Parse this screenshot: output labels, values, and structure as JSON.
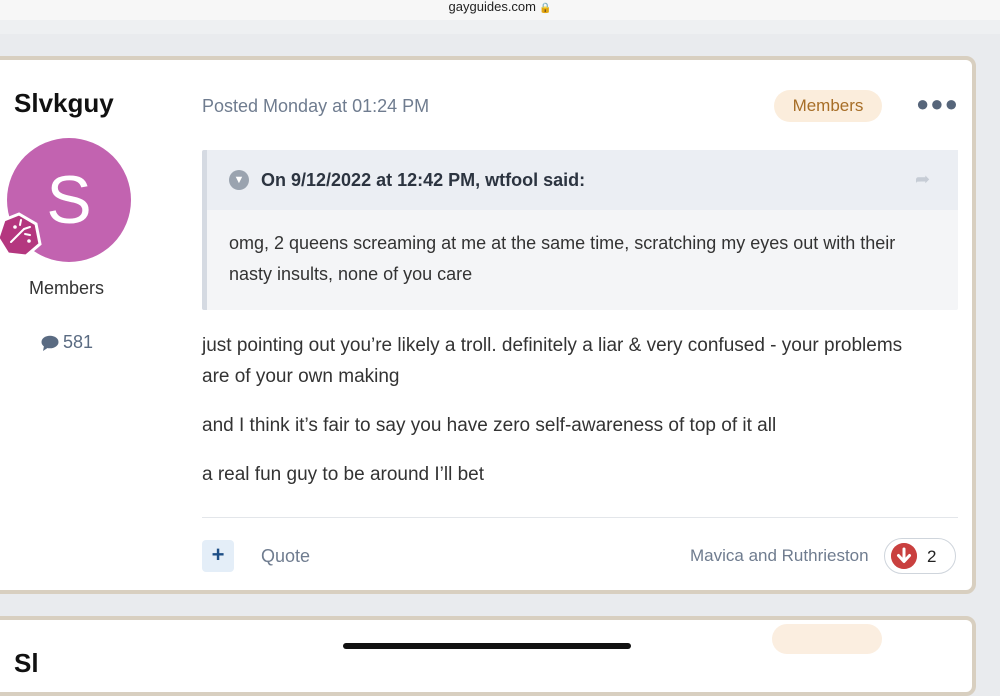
{
  "browser": {
    "url": "gayguides.com"
  },
  "post": {
    "author": "Slvkguy",
    "avatar_letter": "S",
    "group": "Members",
    "post_count": "581",
    "posted": "Posted Monday at 01:24 PM",
    "badge": "Members",
    "quote": {
      "citation": "On 9/12/2022 at 12:42 PM, wtfool said:",
      "body": "omg, 2 queens screaming at me at the same time, scratching my eyes out with their nasty insults, none of you care"
    },
    "paragraphs": [
      "just pointing out you’re likely a troll.  definitely a liar & very confused -  your problems are of your own making",
      "and I think it’s fair to say you have zero self-awareness of top of it all",
      "a real fun guy to be around I’ll bet"
    ],
    "actions": {
      "plus": "+",
      "quote": "Quote"
    },
    "reactions": {
      "users": "Mavica and Ruthrieston",
      "count": "2"
    },
    "colors": {
      "avatar": "#c263b0",
      "reaction": "#c9403f",
      "badge_bg": "#fbeddc",
      "badge_text": "#a76e27"
    }
  },
  "next_post": {
    "author_partial": "Sl"
  }
}
